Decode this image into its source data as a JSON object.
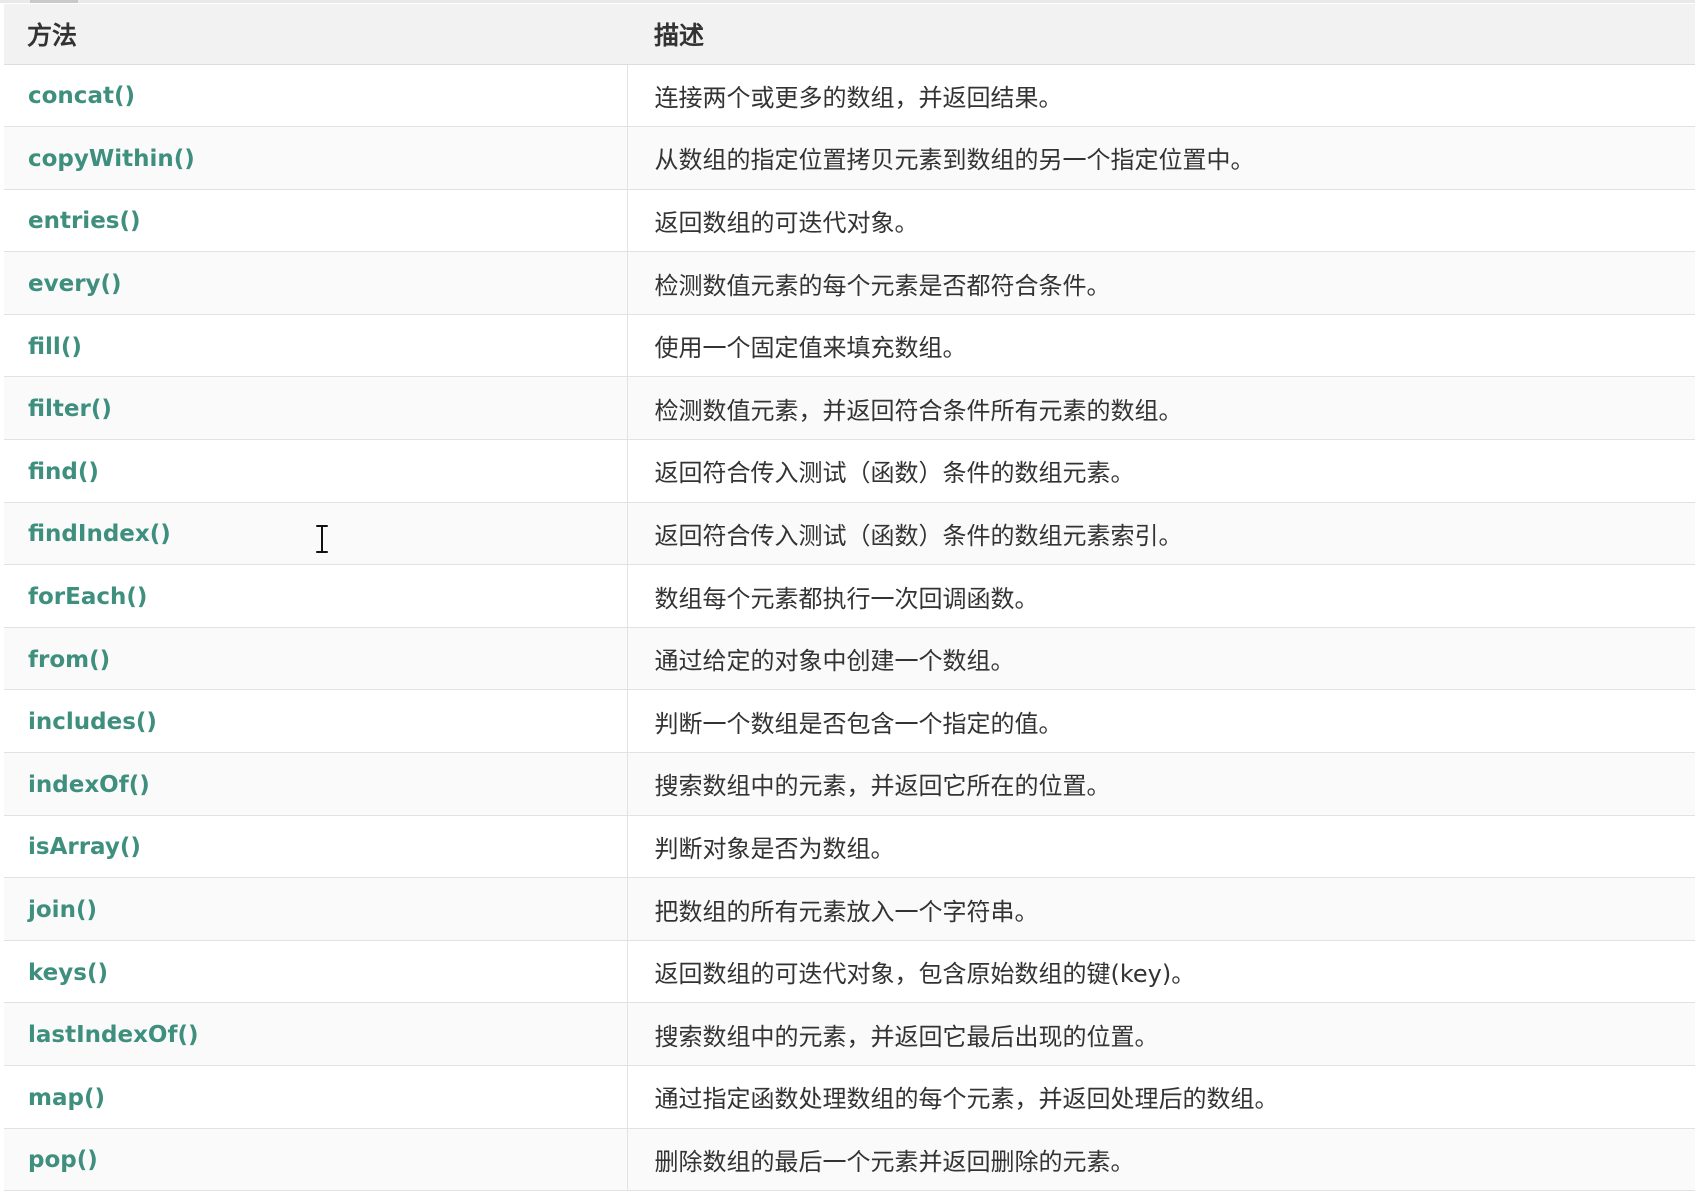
{
  "table": {
    "headers": {
      "method": "方法",
      "description": "描述"
    },
    "rows": [
      {
        "method": "concat()",
        "description": "连接两个或更多的数组，并返回结果。"
      },
      {
        "method": "copyWithin()",
        "description": "从数组的指定位置拷贝元素到数组的另一个指定位置中。"
      },
      {
        "method": "entries()",
        "description": "返回数组的可迭代对象。"
      },
      {
        "method": "every()",
        "description": "检测数值元素的每个元素是否都符合条件。"
      },
      {
        "method": "fill()",
        "description": "使用一个固定值来填充数组。"
      },
      {
        "method": "filter()",
        "description": "检测数值元素，并返回符合条件所有元素的数组。"
      },
      {
        "method": "find()",
        "description": "返回符合传入测试（函数）条件的数组元素。"
      },
      {
        "method": "findIndex()",
        "description": "返回符合传入测试（函数）条件的数组元素索引。"
      },
      {
        "method": "forEach()",
        "description": "数组每个元素都执行一次回调函数。"
      },
      {
        "method": "from()",
        "description": "通过给定的对象中创建一个数组。"
      },
      {
        "method": "includes()",
        "description": "判断一个数组是否包含一个指定的值。"
      },
      {
        "method": "indexOf()",
        "description": "搜索数组中的元素，并返回它所在的位置。"
      },
      {
        "method": "isArray()",
        "description": "判断对象是否为数组。"
      },
      {
        "method": "join()",
        "description": "把数组的所有元素放入一个字符串。"
      },
      {
        "method": "keys()",
        "description": "返回数组的可迭代对象，包含原始数组的键(key)。"
      },
      {
        "method": "lastIndexOf()",
        "description": "搜索数组中的元素，并返回它最后出现的位置。"
      },
      {
        "method": "map()",
        "description": "通过指定函数处理数组的每个元素，并返回处理后的数组。"
      },
      {
        "method": "pop()",
        "description": "删除数组的最后一个元素并返回删除的元素。"
      }
    ]
  },
  "colors": {
    "link": "#3f8f7f",
    "header_bg": "#f2f2f2",
    "border": "#e2e2e2",
    "text": "#333333"
  },
  "icons": {
    "cursor": "text-cursor-icon"
  }
}
